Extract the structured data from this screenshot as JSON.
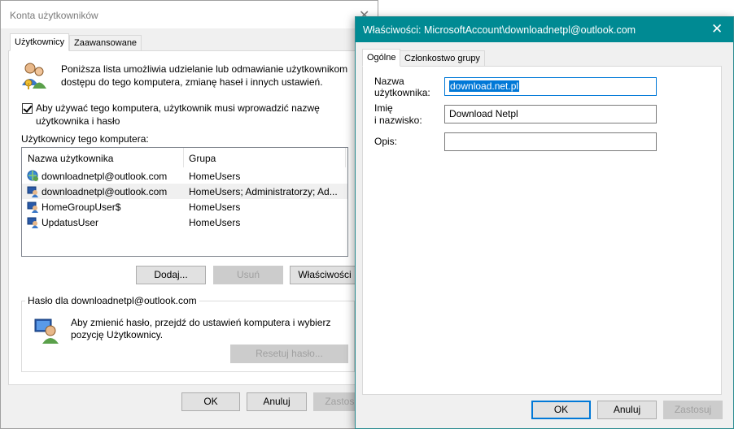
{
  "back_window": {
    "title": "Konta użytkowników",
    "tabs": [
      {
        "label": "Użytkownicy",
        "active": true
      },
      {
        "label": "Zaawansowane",
        "active": false
      }
    ],
    "intro_text_line1": "Poniższa lista umożliwia udzielanie lub odmawianie użytkownikom",
    "intro_text_line2": "dostępu do tego komputera, zmianę haseł i innych ustawień.",
    "require_password_checkbox": {
      "checked": true,
      "label_line1": "Aby używać tego komputera, użytkownik musi wprowadzić nazwę",
      "label_line2": "użytkownika i hasło"
    },
    "users_label": "Użytkownicy tego komputera:",
    "users_table": {
      "columns": [
        "Nazwa użytkownika",
        "Grupa"
      ],
      "rows": [
        {
          "name": "downloadnetpl@outlook.com",
          "group": "HomeUsers",
          "icon": "globe-user-icon",
          "selected": false
        },
        {
          "name": "downloadnetpl@outlook.com",
          "group": "HomeUsers; Administratorzy; Ad...",
          "icon": "admin-user-icon",
          "selected": true
        },
        {
          "name": "HomeGroupUser$",
          "group": "HomeUsers",
          "icon": "user-icon",
          "selected": false
        },
        {
          "name": "UpdatusUser",
          "group": "HomeUsers",
          "icon": "user-icon",
          "selected": false
        }
      ]
    },
    "buttons": {
      "add": "Dodaj...",
      "remove": "Usuń",
      "properties": "Właściwości"
    },
    "password_group": {
      "label": "Hasło dla downloadnetpl@outlook.com",
      "text_line1": "Aby zmienić hasło, przejdź do ustawień komputera i wybierz",
      "text_line2": "pozycję Użytkownicy.",
      "reset_button": "Resetuj hasło..."
    },
    "footer_buttons": {
      "ok": "OK",
      "cancel": "Anuluj",
      "apply": "Zastosuj"
    }
  },
  "front_window": {
    "title": "Właściwości: MicrosoftAccount\\downloadnetpl@outlook.com",
    "tabs": [
      {
        "label": "Ogólne",
        "active": true
      },
      {
        "label": "Członkostwo grupy",
        "active": false
      }
    ],
    "fields": {
      "username_label_line1": "Nazwa",
      "username_label_line2": "użytkownika:",
      "username_value": "download.net.pl",
      "fullname_label_line1": "Imię",
      "fullname_label_line2": "i nazwisko:",
      "fullname_value": "Download Netpl",
      "description_label": "Opis:",
      "description_value": ""
    },
    "footer_buttons": {
      "ok": "OK",
      "cancel": "Anuluj",
      "apply": "Zastosuj"
    }
  },
  "colors": {
    "accent_titlebar": "#008a93",
    "selection": "#0078d7"
  }
}
